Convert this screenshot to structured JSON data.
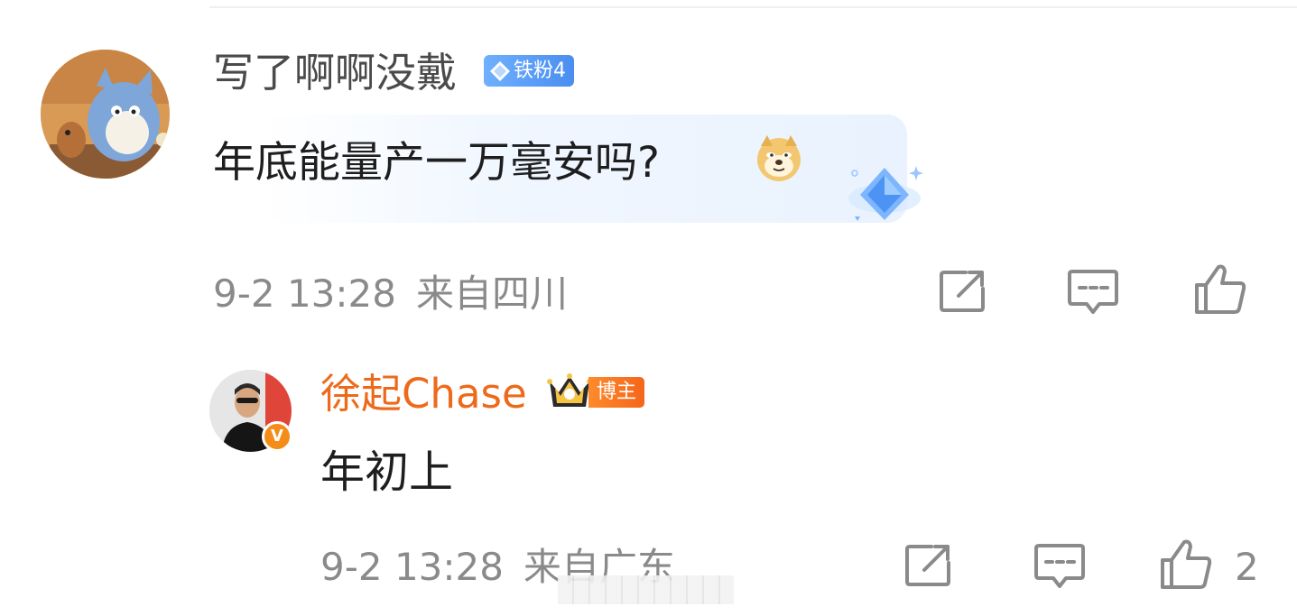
{
  "comment": {
    "username": "写了啊啊没戴",
    "fan_badge": "铁粉4",
    "text": "年底能量产一万毫安吗?",
    "emoji": "doge-emoji",
    "date": "9-2 13:28",
    "location": "来自四川",
    "actions": [
      "share-icon",
      "comment-icon",
      "like-icon"
    ]
  },
  "reply": {
    "username": "徐起Chase",
    "verified_mark": "V",
    "role_badge": "博主",
    "text": "年初上",
    "date": "9-2 13:28",
    "location": "来自广东",
    "like_count": "2",
    "actions": [
      "share-icon",
      "comment-icon",
      "like-icon"
    ]
  },
  "colors": {
    "username_default": "#4a4a4a",
    "username_blogger": "#ee6a1b",
    "meta": "#8a8a8a",
    "fan_badge": "#5a9cf6",
    "blogger_badge": "#f4661b"
  }
}
